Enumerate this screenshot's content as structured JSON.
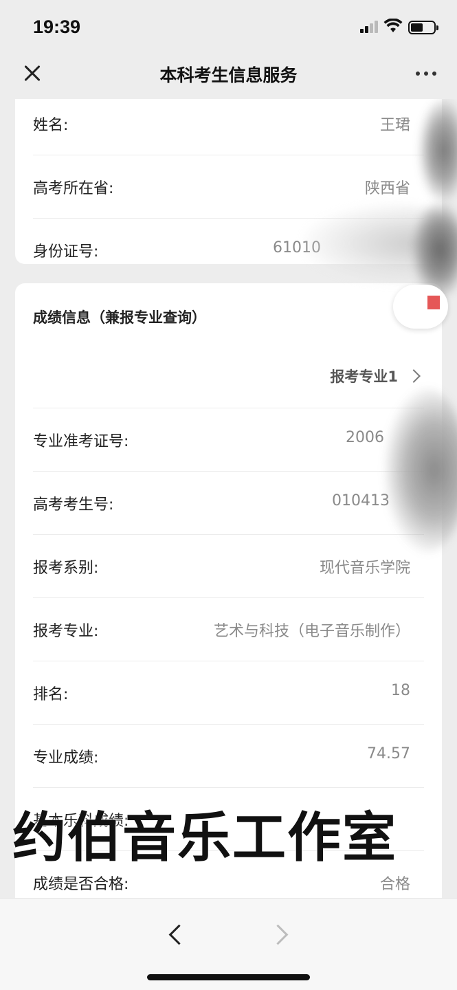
{
  "status_bar": {
    "time": "19:39"
  },
  "nav": {
    "title": "本科考生信息服务"
  },
  "personal": {
    "rows": [
      {
        "label": "姓名:",
        "value": "王珺"
      },
      {
        "label": "高考所在省:",
        "value": "陕西省"
      },
      {
        "label": "身份证号:",
        "value": "61010"
      }
    ]
  },
  "score": {
    "section_title": "成绩信息（兼报专业查询）",
    "major_link": "报考专业1",
    "rows": [
      {
        "label": "专业准考证号:",
        "value": "2006"
      },
      {
        "label": "高考考生号:",
        "value": "010413"
      },
      {
        "label": "报考系别:",
        "value": "现代音乐学院"
      },
      {
        "label": "报考专业:",
        "value": "艺术与科技（电子音乐制作）"
      },
      {
        "label": "排名:",
        "value": "18"
      },
      {
        "label": "专业成绩:",
        "value": "74.57"
      },
      {
        "label": "基本乐科成绩:",
        "value": ""
      },
      {
        "label": "成绩是否合格:",
        "value": "合格"
      }
    ]
  },
  "watermark": "约伯音乐工作室",
  "icons": [
    "close-icon",
    "more-icon",
    "chevron-right-icon",
    "back-arrow-icon",
    "forward-arrow-icon",
    "signal-icon",
    "wifi-icon",
    "battery-icon"
  ]
}
